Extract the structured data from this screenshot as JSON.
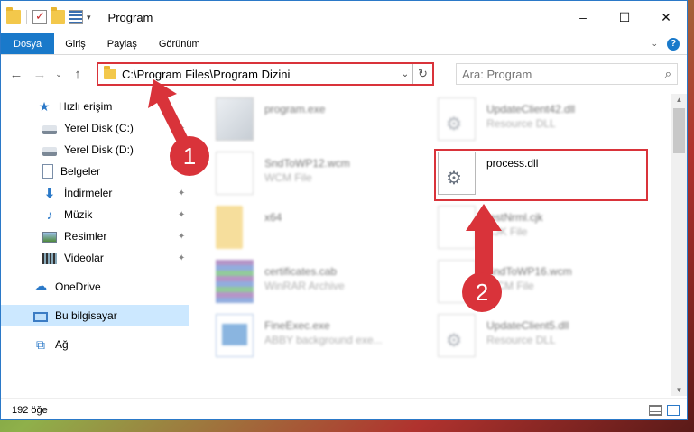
{
  "window": {
    "title": "Program",
    "controls": {
      "minimize": "–",
      "maximize": "☐",
      "close": "✕"
    }
  },
  "ribbon": {
    "tabs": [
      "Dosya",
      "Giriş",
      "Paylaş",
      "Görünüm"
    ],
    "help": "?"
  },
  "nav": {
    "back": "←",
    "forward": "→",
    "recent": "⌄",
    "up": "↑",
    "address": "C:\\Program Files\\Program Dizini",
    "address_dropdown": "⌄",
    "refresh": "↻",
    "search_placeholder": "Ara: Program",
    "search_icon": "⌕"
  },
  "sidebar": {
    "quick_access": "Hızlı erişim",
    "items": [
      {
        "label": "Yerel Disk (C:)",
        "icon": "drive-icon",
        "pinned": true
      },
      {
        "label": "Yerel Disk (D:)",
        "icon": "drive-icon",
        "pinned": false
      },
      {
        "label": "Belgeler",
        "icon": "documents-icon",
        "pinned": true
      },
      {
        "label": "İndirmeler",
        "icon": "downloads-icon",
        "pinned": true
      },
      {
        "label": "Müzik",
        "icon": "music-icon",
        "pinned": true
      },
      {
        "label": "Resimler",
        "icon": "pictures-icon",
        "pinned": true
      },
      {
        "label": "Videolar",
        "icon": "videos-icon",
        "pinned": true
      }
    ],
    "onedrive": "OneDrive",
    "this_pc": "Bu bilgisayar",
    "network": "Ağ",
    "pin_glyph": "📌"
  },
  "files": {
    "left": [
      {
        "name": "program.exe",
        "desc": ""
      },
      {
        "name": "SndToWP12.wcm",
        "desc": "WCM File"
      },
      {
        "name": "x64",
        "desc": ""
      },
      {
        "name": "certificates.cab",
        "desc": "WinRAR Archive"
      },
      {
        "name": "FineExec.exe",
        "desc": "ABBY background exe..."
      }
    ],
    "right": [
      {
        "name": "UpdateClient42.dll",
        "desc": "Resource DLL"
      },
      {
        "name": "process.dll",
        "desc": ""
      },
      {
        "name": "testNrml.cjk",
        "desc": "CJK File"
      },
      {
        "name": "SndToWP16.wcm",
        "desc": "WCM File"
      },
      {
        "name": "UpdateClient5.dll",
        "desc": "Resource DLL"
      }
    ]
  },
  "status": {
    "count": "192 öğe"
  },
  "annotations": {
    "step1": "1",
    "step2": "2"
  },
  "colors": {
    "accent": "#1979ca",
    "annotation_red": "#d9333a"
  }
}
